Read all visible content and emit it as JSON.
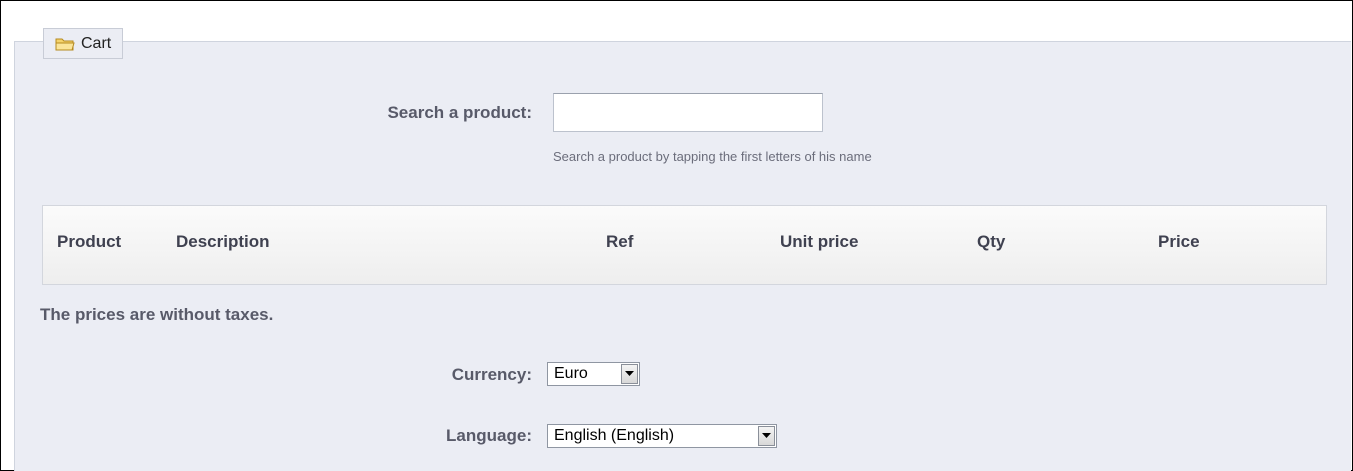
{
  "fieldset": {
    "legend": "Cart"
  },
  "search": {
    "label": "Search a product:",
    "value": "",
    "placeholder": "",
    "hint": "Search a product by tapping the first letters of his name"
  },
  "table": {
    "columns": {
      "product": "Product",
      "description": "Description",
      "ref": "Ref",
      "unit_price": "Unit price",
      "qty": "Qty",
      "price": "Price"
    }
  },
  "notice": "The prices are without taxes.",
  "currency": {
    "label": "Currency:",
    "selected": "Euro"
  },
  "language": {
    "label": "Language:",
    "selected": "English (English)"
  },
  "icons": {
    "legend_icon": "folder-icon",
    "dropdown_icon": "chevron-down-icon"
  },
  "colors": {
    "panel_background": "#ebedf4",
    "label_text": "#585a69"
  }
}
